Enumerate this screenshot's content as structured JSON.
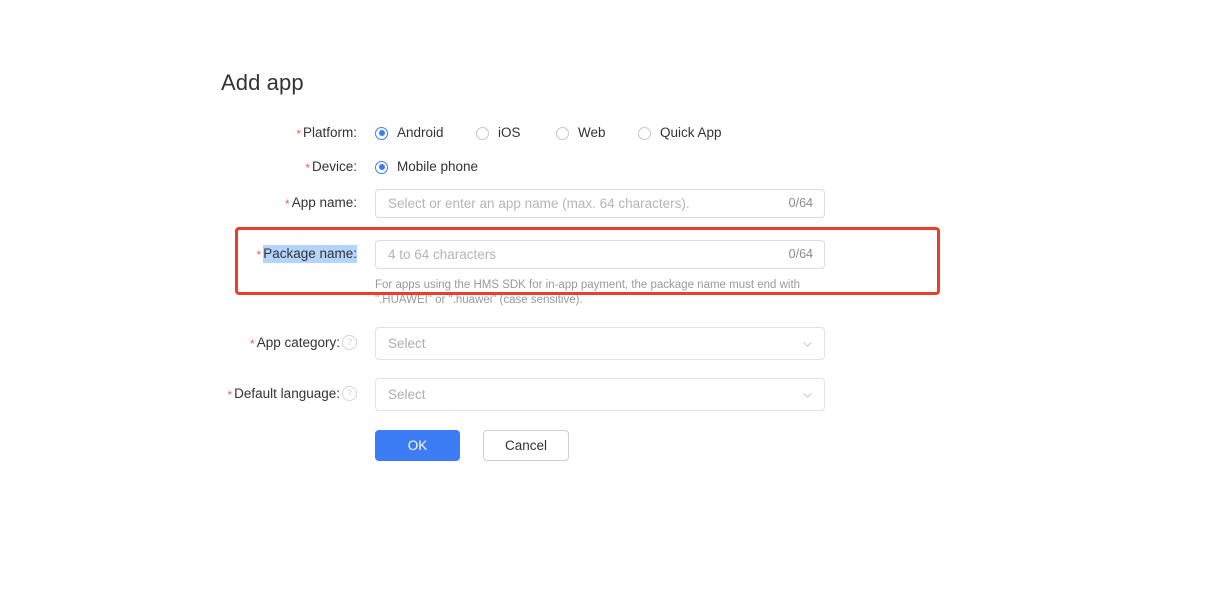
{
  "page": {
    "title": "Add app"
  },
  "theme": {
    "accent_blue": "#3c7df6",
    "required_asterisk": "#f55b5b",
    "annotation_red": "#e8402a",
    "selection_highlight": "#b3d4fc",
    "placeholder_gray": "#b5b5b5",
    "label_text": "#333333"
  },
  "form": {
    "platform": {
      "label": "Platform:",
      "required": "*",
      "options": [
        {
          "label": "Android",
          "selected": true
        },
        {
          "label": "iOS",
          "selected": false
        },
        {
          "label": "Web",
          "selected": false
        },
        {
          "label": "Quick App",
          "selected": false
        }
      ]
    },
    "device": {
      "label": "Device:",
      "required": "*",
      "options": [
        {
          "label": "Mobile phone",
          "selected": true
        }
      ]
    },
    "app_name": {
      "label": "App name:",
      "required": "*",
      "value": "",
      "placeholder": "Select or enter an app name (max. 64 characters).",
      "counter": "0/64"
    },
    "package_name": {
      "label": "Package name:",
      "required": "*",
      "value": "",
      "placeholder": "4 to 64 characters",
      "counter": "0/64",
      "label_selected": true,
      "helper_line1": "For apps using the HMS SDK for in-app payment, the package name must end with",
      "helper_line2": "\".HUAWEI\" or \".huawei\" (case sensitive)."
    },
    "app_category": {
      "label": "App category:",
      "required": "*",
      "help_icon": "question-mark-circle-icon",
      "value": "",
      "placeholder": "Select"
    },
    "default_language": {
      "label": "Default language:",
      "required": "*",
      "help_icon": "question-mark-circle-icon",
      "value": "",
      "placeholder": "Select"
    }
  },
  "actions": {
    "ok_label": "OK",
    "cancel_label": "Cancel"
  }
}
